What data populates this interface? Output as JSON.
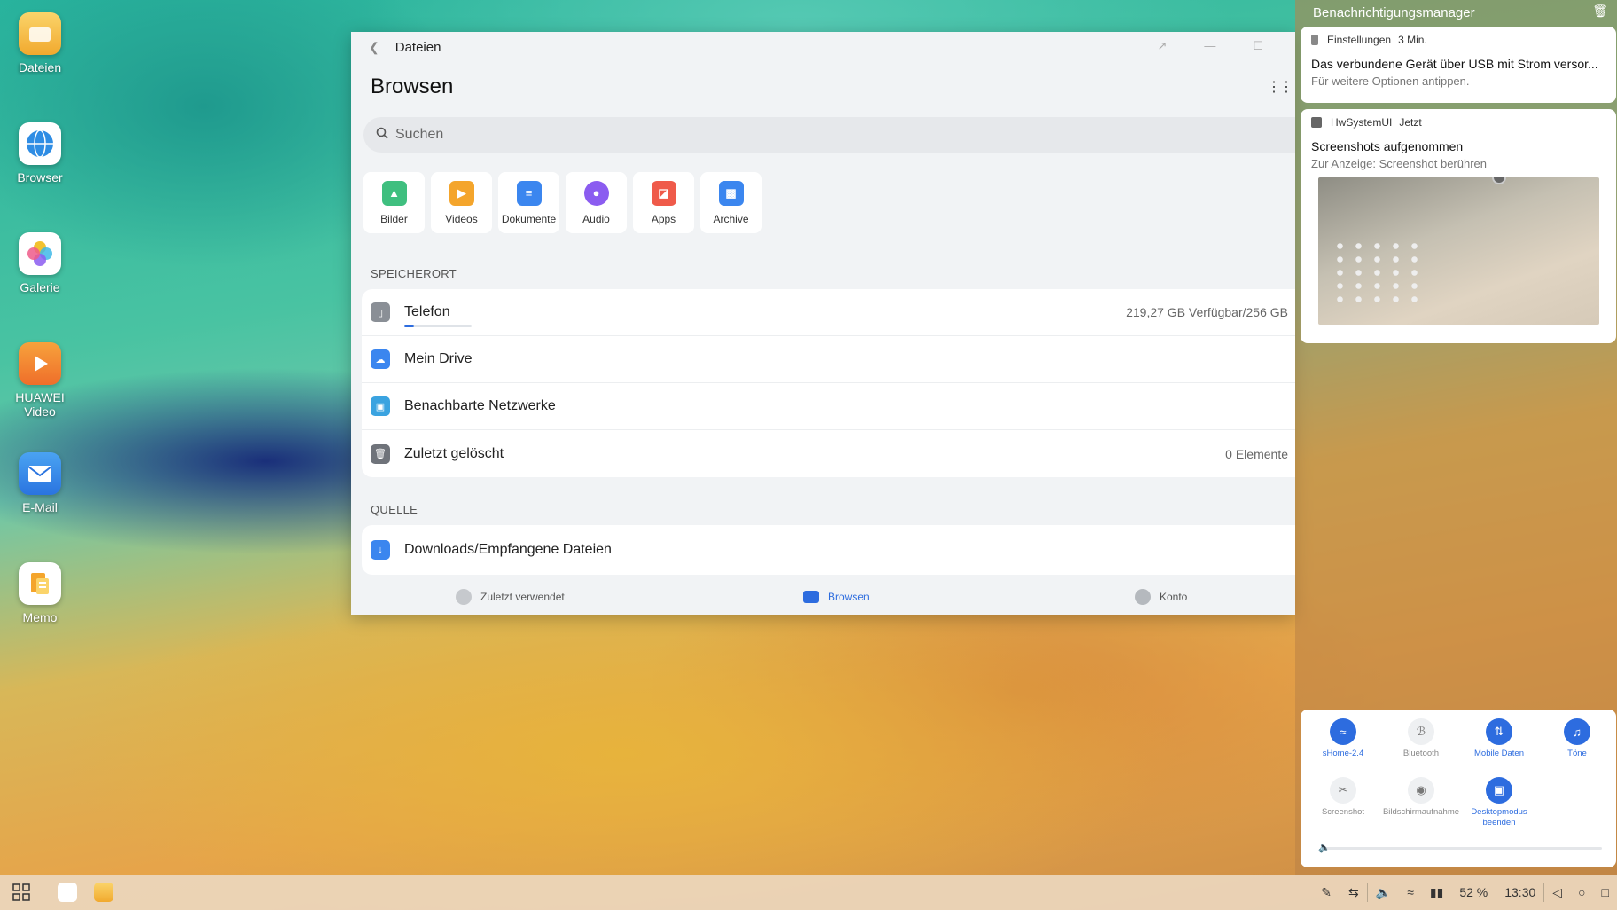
{
  "desktop": {
    "icons": [
      {
        "label": "Dateien",
        "icon": "folder-icon",
        "color": "#f3b943"
      },
      {
        "label": "Browser",
        "icon": "globe-icon",
        "color": "#2f8de4"
      },
      {
        "label": "Galerie",
        "icon": "flower-icon",
        "color": "#ffffff"
      },
      {
        "label": "HUAWEI Video",
        "icon": "play-icon",
        "color": "#f28a2e"
      },
      {
        "label": "E-Mail",
        "icon": "mail-icon",
        "color": "#2f8de4"
      },
      {
        "label": "Memo",
        "icon": "memo-icon",
        "color": "#ffffff"
      }
    ]
  },
  "files_window": {
    "title": "Dateien",
    "heading": "Browsen",
    "search_placeholder": "Suchen",
    "categories": [
      {
        "label": "Bilder",
        "icon": "image-icon",
        "color": "#3fbf7f"
      },
      {
        "label": "Videos",
        "icon": "video-icon",
        "color": "#f4a52c"
      },
      {
        "label": "Dokumente",
        "icon": "document-icon",
        "color": "#3b86ef"
      },
      {
        "label": "Audio",
        "icon": "audio-icon",
        "color": "#8b5cf0"
      },
      {
        "label": "Apps",
        "icon": "apps-icon",
        "color": "#ef5a4a"
      },
      {
        "label": "Archive",
        "icon": "archive-icon",
        "color": "#3b86ef"
      }
    ],
    "storage_section": "SPEICHERORT",
    "storage": [
      {
        "label": "Telefon",
        "detail": "219,27 GB Verfügbar/256 GB",
        "icon": "phone-icon",
        "color": "#8a8f96",
        "used_fraction": 0.14
      },
      {
        "label": "Mein Drive",
        "detail": "",
        "icon": "cloud-icon",
        "color": "#3b86ef"
      },
      {
        "label": "Benachbarte Netzwerke",
        "detail": "",
        "icon": "network-icon",
        "color": "#3aa3e0"
      },
      {
        "label": "Zuletzt gelöscht",
        "detail": "0 Elemente",
        "icon": "trash-icon",
        "color": "#6f737a"
      }
    ],
    "source_section": "QUELLE",
    "sources": [
      {
        "label": "Downloads/Empfangene Dateien",
        "icon": "download-icon",
        "color": "#3b86ef"
      }
    ],
    "nav": {
      "recent": "Zuletzt verwendet",
      "browse": "Browsen",
      "account": "Konto"
    }
  },
  "notifications": {
    "title": "Benachrichtigungsmanager",
    "items": [
      {
        "app": "Einstellungen",
        "time": "3 Min.",
        "title": "Das verbundene Gerät über USB mit Strom versor...",
        "body": "Für weitere Optionen antippen."
      },
      {
        "app": "HwSystemUI",
        "time": "Jetzt",
        "title": "Screenshots aufgenommen",
        "body": "Zur Anzeige: Screenshot berühren"
      }
    ]
  },
  "quick_settings": {
    "tiles": [
      {
        "label": "sHome-2.4",
        "state": "on",
        "icon": "wifi-icon"
      },
      {
        "label": "Bluetooth",
        "state": "off",
        "icon": "bluetooth-icon"
      },
      {
        "label": "Mobile Daten",
        "state": "on",
        "icon": "mobile-data-icon"
      },
      {
        "label": "Töne",
        "state": "on",
        "icon": "bell-icon"
      },
      {
        "label": "Screenshot",
        "state": "off",
        "icon": "screenshot-icon"
      },
      {
        "label": "Bildschirmaufnahme",
        "state": "off",
        "icon": "screen-record-icon"
      },
      {
        "label": "Desktopmodus beenden",
        "state": "on",
        "icon": "desktop-mode-icon"
      }
    ],
    "volume_fraction": 0.02
  },
  "taskbar": {
    "battery": "52 %",
    "time": "13:30"
  },
  "colors": {
    "accent": "#2d6cdf"
  }
}
